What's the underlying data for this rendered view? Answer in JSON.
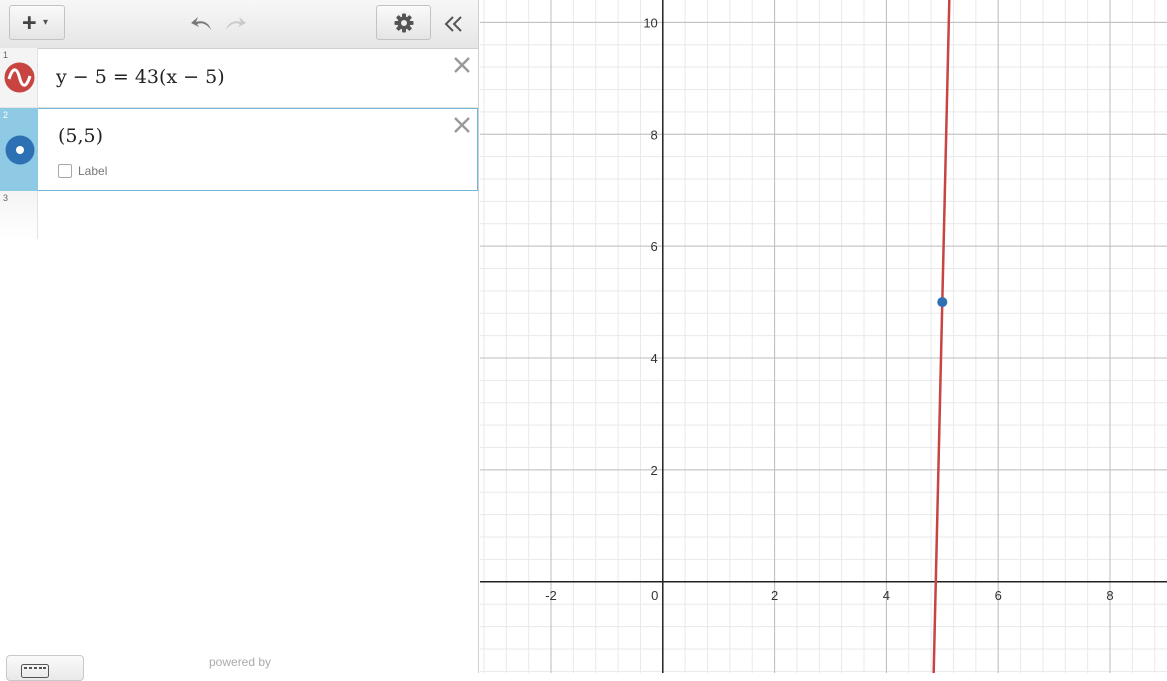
{
  "toolbar": {
    "add": "+",
    "caret": "▾"
  },
  "expressions": [
    {
      "index": "1",
      "latex": "y − 5 = 43(x − 5)",
      "color": "#c74440"
    },
    {
      "index": "2",
      "latex": "(5,5)",
      "label_text": "Label",
      "color": "#2d70b3"
    },
    {
      "index": "3"
    }
  ],
  "footer": {
    "powered_by": "powered by"
  },
  "graph": {
    "x_ticks": [
      "-2",
      "0",
      "2",
      "4",
      "6",
      "8"
    ],
    "y_ticks": [
      "2",
      "4",
      "6",
      "8",
      "10"
    ],
    "xlim": [
      -3.27,
      9.02
    ],
    "ylim": [
      -1.63,
      10.4
    ],
    "line": {
      "equation": "y-5=43(x-5)",
      "slope": 43,
      "point": [
        5,
        5
      ],
      "color": "#c74440"
    },
    "point": {
      "x": 5,
      "y": 5,
      "color": "#2d70b3"
    }
  }
}
